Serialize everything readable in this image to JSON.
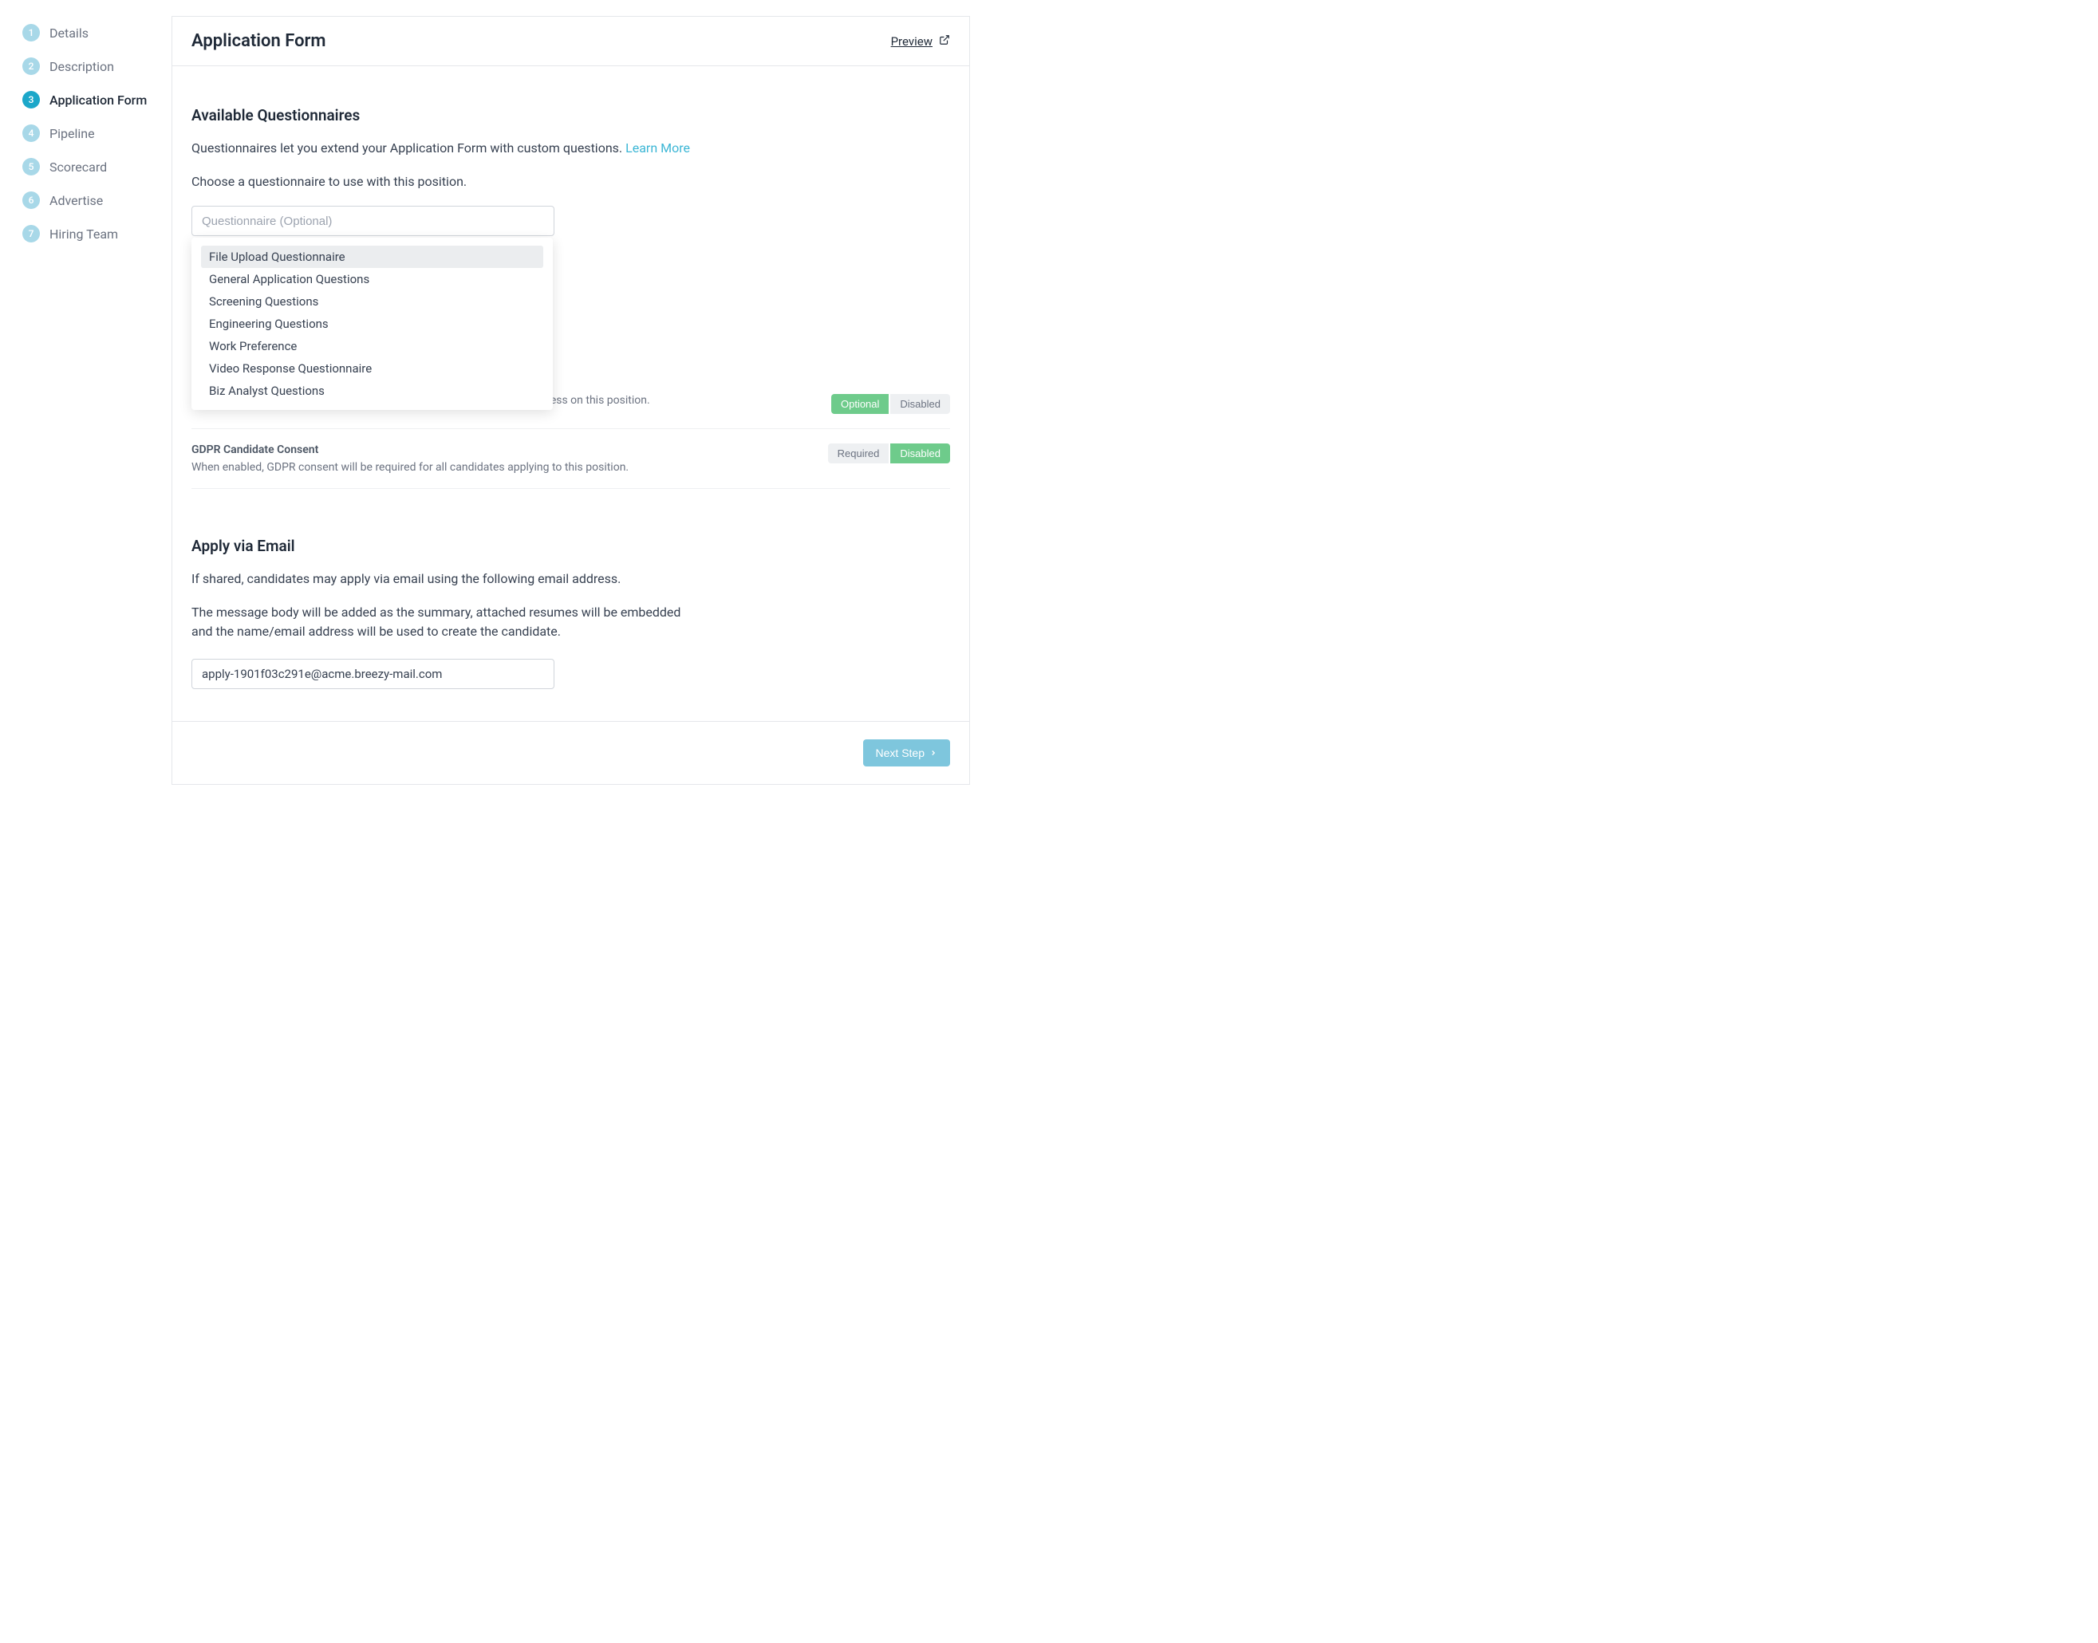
{
  "sidebar": {
    "steps": [
      {
        "num": "1",
        "label": "Details"
      },
      {
        "num": "2",
        "label": "Description"
      },
      {
        "num": "3",
        "label": "Application Form"
      },
      {
        "num": "4",
        "label": "Pipeline"
      },
      {
        "num": "5",
        "label": "Scorecard"
      },
      {
        "num": "6",
        "label": "Advertise"
      },
      {
        "num": "7",
        "label": "Hiring Team"
      }
    ],
    "active_index": 2
  },
  "header": {
    "title": "Application Form",
    "preview_label": "Preview"
  },
  "questionnaires": {
    "title": "Available Questionnaires",
    "description": "Questionnaires let you extend your Application Form with custom questions. ",
    "learn_more": "Learn More",
    "choose_text": "Choose a questionnaire to use with this position.",
    "placeholder": "Questionnaire (Optional)",
    "options": [
      "File Upload Questionnaire",
      "General Application Questions",
      "Screening Questions",
      "Engineering Questions",
      "Work Preference",
      "Video Response Questionnaire",
      "Biz Analyst Questions"
    ],
    "highlight_index": 0
  },
  "compliance": {
    "eeoc": {
      "title_partial": "When enabled, EEOC compliant forms will be part of the application process on this position.",
      "option1": "Optional",
      "option2": "Disabled",
      "active": "Optional"
    },
    "gdpr": {
      "title": "GDPR Candidate Consent",
      "desc": "When enabled, GDPR consent will be required for all candidates applying to this position.",
      "option1": "Required",
      "option2": "Disabled",
      "active": "Disabled"
    }
  },
  "apply_email": {
    "title": "Apply via Email",
    "desc1": "If shared, candidates may apply via email using the following email address.",
    "desc2": "The message body will be added as the summary, attached resumes will be embedded and the name/email address will be used to create the candidate.",
    "email": "apply-1901f03c291e@acme.breezy-mail.com"
  },
  "footer": {
    "next_label": "Next Step"
  }
}
